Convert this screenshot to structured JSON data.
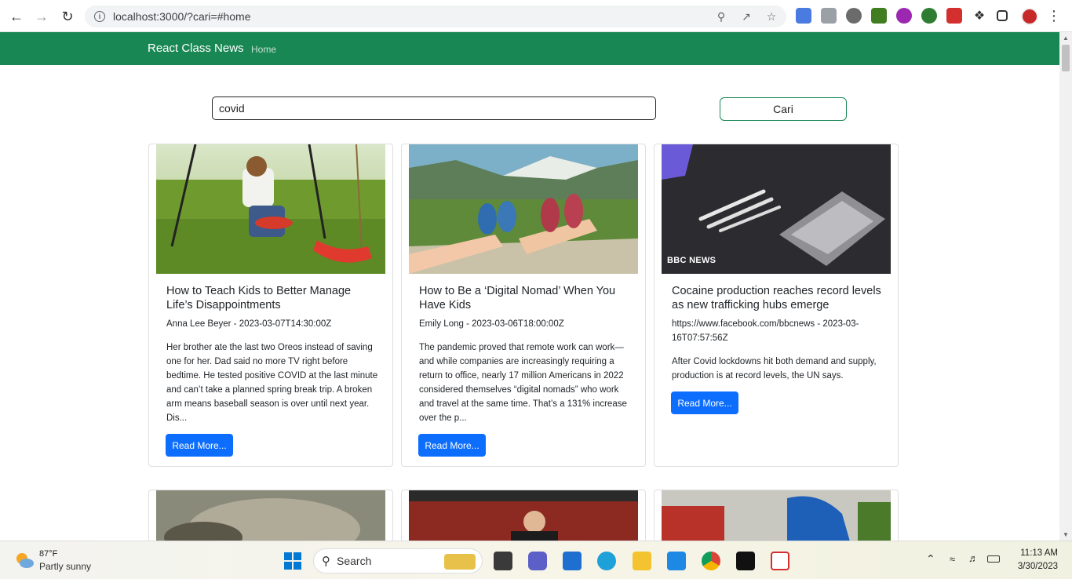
{
  "browser": {
    "url": "localhost:3000/?cari=#home"
  },
  "navbar": {
    "brand": "React Class News",
    "home_label": "Home"
  },
  "search": {
    "value": "covid",
    "button_label": "Cari"
  },
  "cards": [
    {
      "title": "How to Teach Kids to Better Manage Life’s Disappointments",
      "meta": "Anna Lee Beyer - 2023-03-07T14:30:00Z",
      "description": "Her brother ate the last two Oreos instead of saving one for her. Dad said no more TV right before bedtime. He tested positive COVID at the last minute and can’t take a planned spring break trip. A broken arm means baseball season is over until next year. Dis...",
      "button_label": "Read More..."
    },
    {
      "title": "How to Be a ‘Digital Nomad’ When You Have Kids",
      "meta": "Emily Long - 2023-03-06T18:00:00Z",
      "description": "The pandemic proved that remote work can work—and while companies are increasingly requiring a return to office, nearly 17 million Americans in 2022 considered themselves “digital nomads” who work and travel at the same time. That’s a 131% increase over the p...",
      "button_label": "Read More..."
    },
    {
      "title": "Cocaine production reaches record levels as new trafficking hubs emerge",
      "meta": "https://www.facebook.com/bbcnews - 2023-03-16T07:57:56Z",
      "description": "After Covid lockdowns hit both demand and supply, production is at record levels, the UN says.",
      "button_label": "Read More...",
      "image_watermark": "BBC NEWS"
    }
  ],
  "taskbar": {
    "weather_temp": "87°F",
    "weather_desc": "Partly sunny",
    "search_label": "Search",
    "time": "11:13 AM",
    "date": "3/30/2023"
  },
  "colors": {
    "navbar": "#198754",
    "primary_button": "#0d6efd"
  }
}
